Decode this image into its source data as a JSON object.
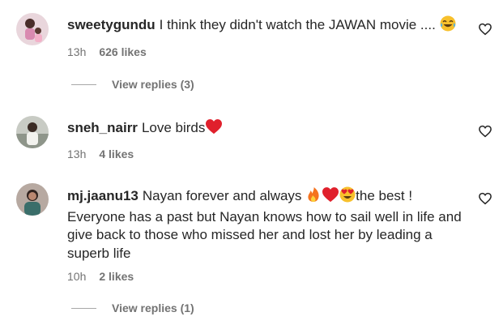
{
  "comments": [
    {
      "username": "sweetygundu",
      "text": "I think they didn't watch the JAWAN movie .... ",
      "emoji": "laughing-tears-emoji",
      "time": "13h",
      "likes": "626 likes",
      "view_replies": "View replies (3)"
    },
    {
      "username": "sneh_nairr",
      "text": "Love birds",
      "emoji": "red-heart-emoji",
      "time": "13h",
      "likes": "4 likes"
    },
    {
      "username": "mj.jaanu13",
      "text_before": "Nayan forever and always ",
      "text_after": "the best ! Everyone has a past but Nayan knows how to sail well in life and give back to those who missed her and lost her by leading a superb life",
      "emojis": [
        "fire-emoji",
        "red-heart-emoji",
        "heart-eyes-emoji"
      ],
      "time": "10h",
      "likes": "2 likes",
      "view_replies": "View replies (1)"
    }
  ],
  "colors": {
    "text": "#262626",
    "meta": "#737373",
    "heart": "#e0202c"
  }
}
